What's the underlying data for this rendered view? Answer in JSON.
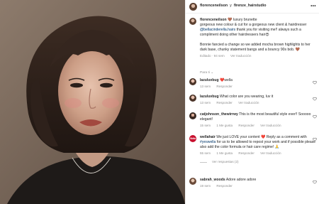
{
  "header": {
    "user1": "florenceneilson",
    "conj": "y",
    "user2": "firenze_hairstudio",
    "more_label": "•••"
  },
  "caption": {
    "username": "florenceneilson",
    "line1_emoji": "🤎",
    "line1_text": "luxury brunette",
    "line2": "gorgeous new colour & cut for a gorgeous new client & hairdresser",
    "mention": "@bellacinderella.hairs",
    "line2b": "thank you for visiting me!! always such a compliment doing other hairdressers hair😍",
    "para2": "Bonnie fancied a change so we added mocha brown highlights to her dark base, chunky statement bangs and a bouncy 90s bob. 🤎",
    "meta_edited": "Editado · 94 sem",
    "meta_translate": "Ver traducción"
  },
  "para_ti": "Para ti ⌄",
  "comments": [
    {
      "username": "lazuluvbug",
      "text": "❤️wella",
      "meta": [
        "13 sem",
        "Responder"
      ]
    },
    {
      "username": "lazuluvbug",
      "text": "What color are you wearing, luv it",
      "meta": [
        "13 sem",
        "Responder",
        "Ver traducción"
      ]
    },
    {
      "username": "catjohnson_thewirrwy",
      "text": "This is the most beautiful style ever!! Sooooo elegant!",
      "meta": [
        "15 sem",
        "1 Me gusta",
        "Responder",
        "Ver traducción"
      ]
    },
    {
      "username": "wellahair",
      "avatar_text": "Wella",
      "text_a": "We just LOVE your content ❤️ Reply as a comment with",
      "mention": "#yeswella",
      "text_b": "for us to be allowed to repost your work and if possible please also add the color formula or hair care regime! 🙏",
      "meta": [
        "55 sem",
        "1 Me gusta",
        "Responder",
        "Ver traducción"
      ],
      "replies": "Ver respuestas (2)"
    },
    {
      "username": "sabrah_woods",
      "text": "Adore adore adore",
      "meta": [
        "19 sem",
        "Responder"
      ]
    }
  ],
  "colors": {
    "link": "#00376b",
    "meta": "#8e8e8e",
    "wella": "#c8102e"
  }
}
